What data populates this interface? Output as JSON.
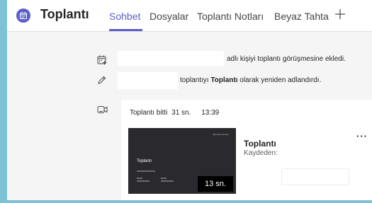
{
  "header": {
    "title": "Toplantı",
    "tabs": [
      {
        "label": "Sohbet",
        "active": true
      },
      {
        "label": "Dosyalar",
        "active": false
      },
      {
        "label": "Toplantı Notları",
        "active": false
      },
      {
        "label": "Beyaz Tahta",
        "active": false
      }
    ],
    "add_tab_icon": "plus-icon",
    "app_icon": "calendar-icon"
  },
  "events": {
    "added": {
      "icon": "calendar-add-icon",
      "text": "adlı kişiyi toplantı görüşmesine ekledi."
    },
    "renamed": {
      "icon": "pencil-icon",
      "text_before": "toplantıyı ",
      "text_bold": "Toplantı",
      "text_after": " olarak yeniden adlandırdı."
    }
  },
  "meeting_card": {
    "icon": "video-camera-icon",
    "ended_label": "Toplantı bitti",
    "ended_duration": "31 sn.",
    "ended_time": "13:39",
    "thumbnail": {
      "brand": "Microsoft Stream",
      "title": "Toplantı",
      "duration": "13 sn."
    },
    "recording_title": "Toplantı",
    "recorded_by_label": "Kaydeden:",
    "more_label": "···"
  },
  "colors": {
    "accent": "#5b5fc7",
    "background": "#f5f5f5",
    "outer": "#7ec3d5",
    "thumbnail": "#2a2a2e"
  }
}
